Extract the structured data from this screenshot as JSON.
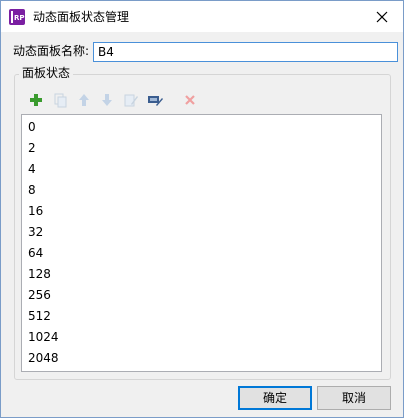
{
  "window": {
    "title": "动态面板状态管理",
    "app_icon_text": "RP"
  },
  "form": {
    "name_label": "动态面板名称:",
    "name_value": "B4"
  },
  "states_group": {
    "title": "面板状态",
    "toolbar": [
      {
        "name": "add",
        "icon": "plus-icon",
        "enabled": true,
        "color": "#3a9b2e"
      },
      {
        "name": "duplicate",
        "icon": "copy-icon",
        "enabled": false
      },
      {
        "name": "move-up",
        "icon": "arrow-up-icon",
        "enabled": false
      },
      {
        "name": "move-down",
        "icon": "arrow-down-icon",
        "enabled": false
      },
      {
        "name": "edit",
        "icon": "edit-states-icon",
        "enabled": false
      },
      {
        "name": "edit-all",
        "icon": "edit-all-states-icon",
        "enabled": true,
        "color": "#3a5d8f"
      },
      {
        "name": "delete",
        "icon": "delete-x-icon",
        "enabled": false,
        "color": "#f0a0a0"
      }
    ],
    "states": [
      "0",
      "2",
      "4",
      "8",
      "16",
      "32",
      "64",
      "128",
      "256",
      "512",
      "1024",
      "2048"
    ]
  },
  "buttons": {
    "ok_label": "确定",
    "cancel_label": "取消"
  }
}
